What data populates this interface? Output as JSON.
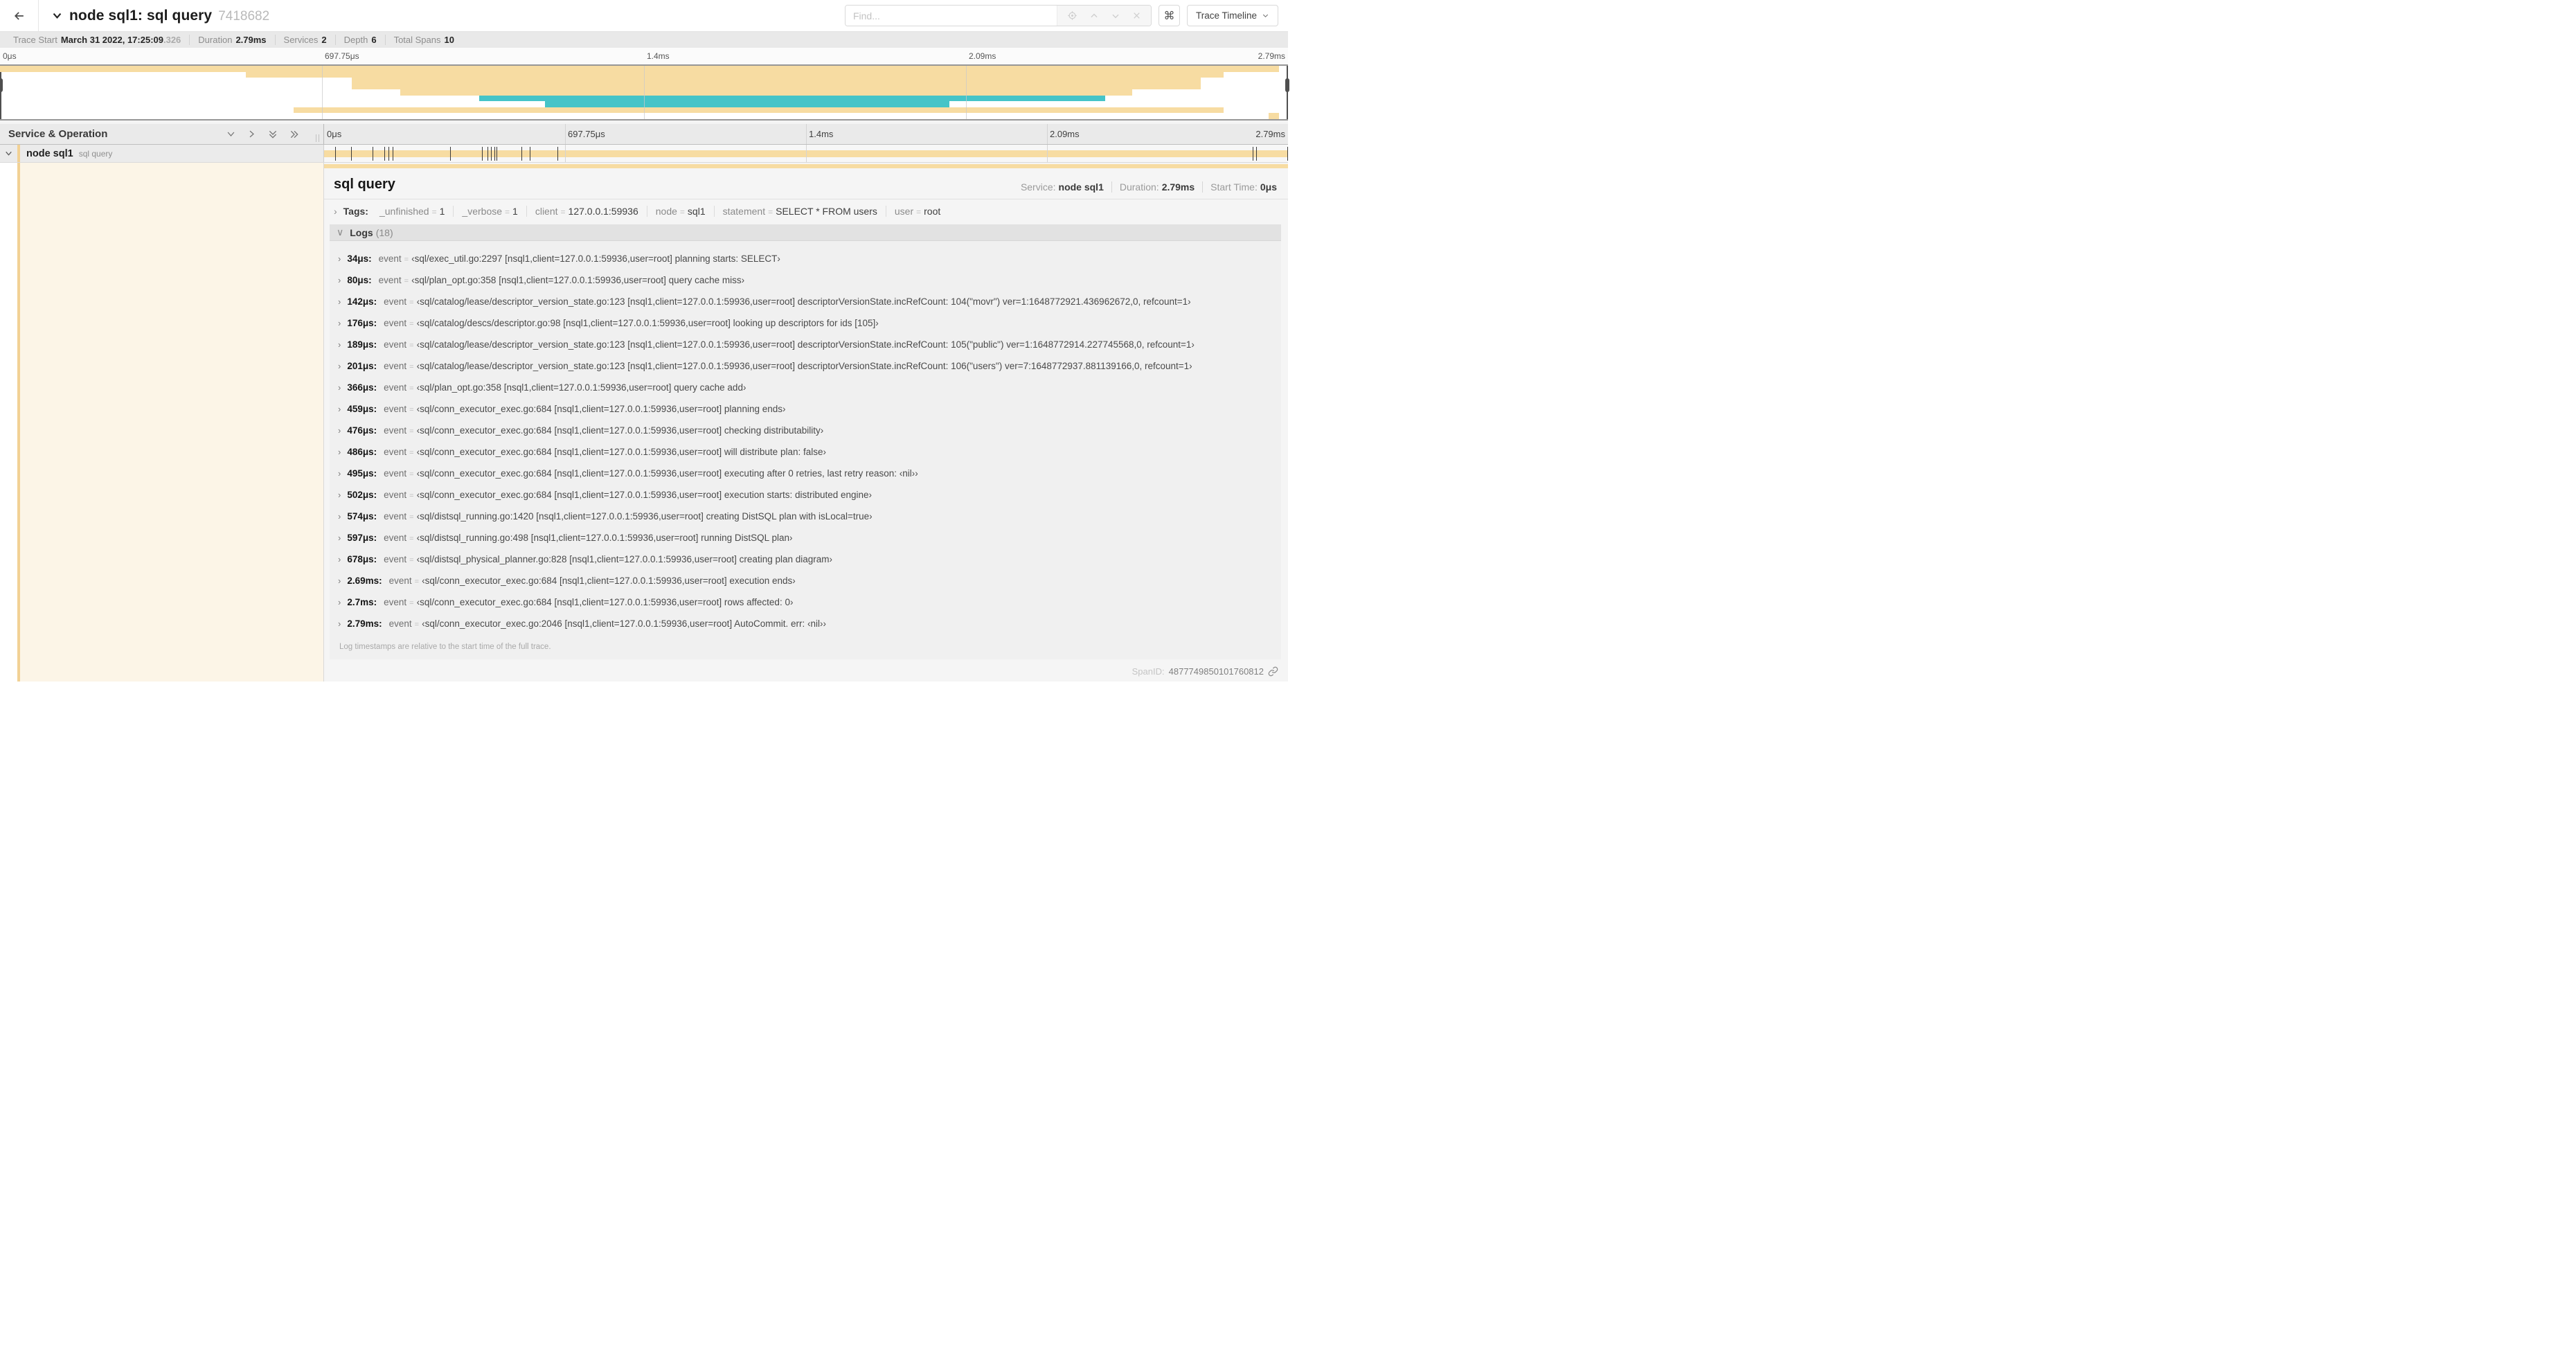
{
  "nav": {
    "title": "node sql1: sql query",
    "trace_id": "7418682",
    "find_placeholder": "Find...",
    "shortcut_key": "⌘",
    "view_selector": "Trace Timeline"
  },
  "summary": {
    "items": [
      {
        "label": "Trace Start",
        "value": "March 31 2022, 17:25:09",
        "suffix": ".326"
      },
      {
        "label": "Duration",
        "value": "2.79ms",
        "suffix": ""
      },
      {
        "label": "Services",
        "value": "2",
        "suffix": ""
      },
      {
        "label": "Depth",
        "value": "6",
        "suffix": ""
      },
      {
        "label": "Total Spans",
        "value": "10",
        "suffix": ""
      }
    ]
  },
  "timeline": {
    "left_header": "Service & Operation",
    "tick_labels": [
      "0μs",
      "697.75μs",
      "1.4ms",
      "2.09ms",
      "2.79ms"
    ],
    "tick_positions_pct": [
      0,
      25,
      50,
      75,
      100
    ],
    "trace_duration_us": 2790
  },
  "minimap": {
    "spans": [
      {
        "row": 0,
        "start_pct": 0.0,
        "end_pct": 99.3,
        "color": "tan"
      },
      {
        "row": 1,
        "start_pct": 19.1,
        "end_pct": 95.0,
        "color": "tan"
      },
      {
        "row": 2,
        "start_pct": 27.3,
        "end_pct": 93.2,
        "color": "tan"
      },
      {
        "row": 3,
        "start_pct": 27.3,
        "end_pct": 93.2,
        "color": "tan"
      },
      {
        "row": 4,
        "start_pct": 31.1,
        "end_pct": 87.9,
        "color": "tan"
      },
      {
        "row": 5,
        "start_pct": 37.2,
        "end_pct": 85.8,
        "color": "teal"
      },
      {
        "row": 6,
        "start_pct": 42.3,
        "end_pct": 73.7,
        "color": "teal"
      },
      {
        "row": 7,
        "start_pct": 22.8,
        "end_pct": 95.0,
        "color": "tan"
      },
      {
        "row": 8,
        "start_pct": 98.5,
        "end_pct": 99.3,
        "color": "tan"
      }
    ]
  },
  "row": {
    "service": "node sql1",
    "operation": "sql query"
  },
  "detail": {
    "title": "sql query",
    "meta": [
      {
        "label": "Service:",
        "value": "node sql1"
      },
      {
        "label": "Duration:",
        "value": "2.79ms"
      },
      {
        "label": "Start Time:",
        "value": "0μs"
      }
    ],
    "tags_label": "Tags:",
    "tags": [
      {
        "key": "_unfinished",
        "value": "1"
      },
      {
        "key": "_verbose",
        "value": "1"
      },
      {
        "key": "client",
        "value": "127.0.0.1:59936"
      },
      {
        "key": "node",
        "value": "sql1"
      },
      {
        "key": "statement",
        "value": "SELECT * FROM users"
      },
      {
        "key": "user",
        "value": "root"
      }
    ],
    "logs_label": "Logs",
    "logs_count": "(18)",
    "logs": [
      {
        "ts": "34μs",
        "t_us": 34,
        "key": "event",
        "msg": "sql/exec_util.go:2297 [nsql1,client=127.0.0.1:59936,user=root] planning starts: SELECT"
      },
      {
        "ts": "80μs",
        "t_us": 80,
        "key": "event",
        "msg": "sql/plan_opt.go:358 [nsql1,client=127.0.0.1:59936,user=root] query cache miss"
      },
      {
        "ts": "142μs",
        "t_us": 142,
        "key": "event",
        "msg": "sql/catalog/lease/descriptor_version_state.go:123 [nsql1,client=127.0.0.1:59936,user=root] descriptorVersionState.incRefCount: 104(\"movr\") ver=1:1648772921.436962672,0, refcount=1"
      },
      {
        "ts": "176μs",
        "t_us": 176,
        "key": "event",
        "msg": "sql/catalog/descs/descriptor.go:98 [nsql1,client=127.0.0.1:59936,user=root] looking up descriptors for ids [105]"
      },
      {
        "ts": "189μs",
        "t_us": 189,
        "key": "event",
        "msg": "sql/catalog/lease/descriptor_version_state.go:123 [nsql1,client=127.0.0.1:59936,user=root] descriptorVersionState.incRefCount: 105(\"public\") ver=1:1648772914.227745568,0, refcount=1"
      },
      {
        "ts": "201μs",
        "t_us": 201,
        "key": "event",
        "msg": "sql/catalog/lease/descriptor_version_state.go:123 [nsql1,client=127.0.0.1:59936,user=root] descriptorVersionState.incRefCount: 106(\"users\") ver=7:1648772937.881139166,0, refcount=1"
      },
      {
        "ts": "366μs",
        "t_us": 366,
        "key": "event",
        "msg": "sql/plan_opt.go:358 [nsql1,client=127.0.0.1:59936,user=root] query cache add"
      },
      {
        "ts": "459μs",
        "t_us": 459,
        "key": "event",
        "msg": "sql/conn_executor_exec.go:684 [nsql1,client=127.0.0.1:59936,user=root] planning ends"
      },
      {
        "ts": "476μs",
        "t_us": 476,
        "key": "event",
        "msg": "sql/conn_executor_exec.go:684 [nsql1,client=127.0.0.1:59936,user=root] checking distributability"
      },
      {
        "ts": "486μs",
        "t_us": 486,
        "key": "event",
        "msg": "sql/conn_executor_exec.go:684 [nsql1,client=127.0.0.1:59936,user=root] will distribute plan: false"
      },
      {
        "ts": "495μs",
        "t_us": 495,
        "key": "event",
        "msg": "sql/conn_executor_exec.go:684 [nsql1,client=127.0.0.1:59936,user=root] executing after 0 retries, last retry reason: ‹nil›"
      },
      {
        "ts": "502μs",
        "t_us": 502,
        "key": "event",
        "msg": "sql/conn_executor_exec.go:684 [nsql1,client=127.0.0.1:59936,user=root] execution starts: distributed engine"
      },
      {
        "ts": "574μs",
        "t_us": 574,
        "key": "event",
        "msg": "sql/distsql_running.go:1420 [nsql1,client=127.0.0.1:59936,user=root] creating DistSQL plan with isLocal=true"
      },
      {
        "ts": "597μs",
        "t_us": 597,
        "key": "event",
        "msg": "sql/distsql_running.go:498 [nsql1,client=127.0.0.1:59936,user=root] running DistSQL plan"
      },
      {
        "ts": "678μs",
        "t_us": 678,
        "key": "event",
        "msg": "sql/distsql_physical_planner.go:828 [nsql1,client=127.0.0.1:59936,user=root] creating plan diagram"
      },
      {
        "ts": "2.69ms",
        "t_us": 2690,
        "key": "event",
        "msg": "sql/conn_executor_exec.go:684 [nsql1,client=127.0.0.1:59936,user=root] execution ends"
      },
      {
        "ts": "2.7ms",
        "t_us": 2700,
        "key": "event",
        "msg": "sql/conn_executor_exec.go:684 [nsql1,client=127.0.0.1:59936,user=root] rows affected: 0"
      },
      {
        "ts": "2.79ms",
        "t_us": 2790,
        "key": "event",
        "msg": "sql/conn_executor_exec.go:2046 [nsql1,client=127.0.0.1:59936,user=root] AutoCommit. err: ‹nil›"
      }
    ],
    "footer": "Log timestamps are relative to the start time of the full trace.",
    "span_id_label": "SpanID:",
    "span_id": "4877749850101760812"
  },
  "colors": {
    "tan": "#F7DCA2",
    "teal": "#45C4C8",
    "row_highlight": "#FCF5E7",
    "stripe": "#F2D194"
  }
}
